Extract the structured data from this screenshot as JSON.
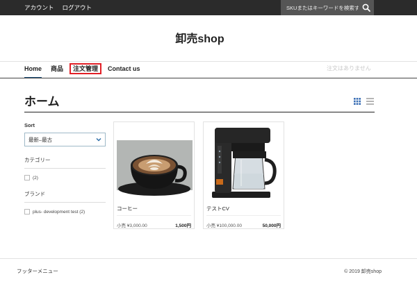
{
  "topbar": {
    "account_label": "アカウント",
    "logout_label": "ログアウト",
    "search_placeholder": "SKUまたはキーワードを検索す",
    "search_icon": "search-icon"
  },
  "logo": "卸売shop",
  "nav": {
    "items": [
      {
        "label": "Home"
      },
      {
        "label": "商品"
      },
      {
        "label": "注文管理"
      },
      {
        "label": "Contact us"
      }
    ],
    "status": "注文はありません"
  },
  "page": {
    "title": "ホーム",
    "view_icons": [
      "grid-view-icon",
      "list-view-icon"
    ]
  },
  "sidebar": {
    "sort_label": "Sort",
    "sort_value": "最新–最古",
    "category_title": "カテゴリー",
    "category_items": [
      {
        "label": "(2)"
      }
    ],
    "brand_title": "ブランド",
    "brand_items": [
      {
        "label": "plus- development test (2)"
      }
    ]
  },
  "products": [
    {
      "name": "コーヒー",
      "retail": "小売 ¥3,000.00",
      "price": "1,500円",
      "image": "coffee-cup-photo"
    },
    {
      "name": "テストCV",
      "retail": "小売 ¥100,000.00",
      "price": "50,000円",
      "image": "coffee-maker-photo"
    }
  ],
  "footer": {
    "menu": "フッターメニュー",
    "copyright": "© 2019 卸売shop"
  },
  "colors": {
    "topbar_bg": "#2b2b2b",
    "search_bg": "#555555",
    "nav_active_underline": "#1a4f7a",
    "highlight_border": "#e21f26",
    "view_grid_icon": "#3b6fb5"
  }
}
